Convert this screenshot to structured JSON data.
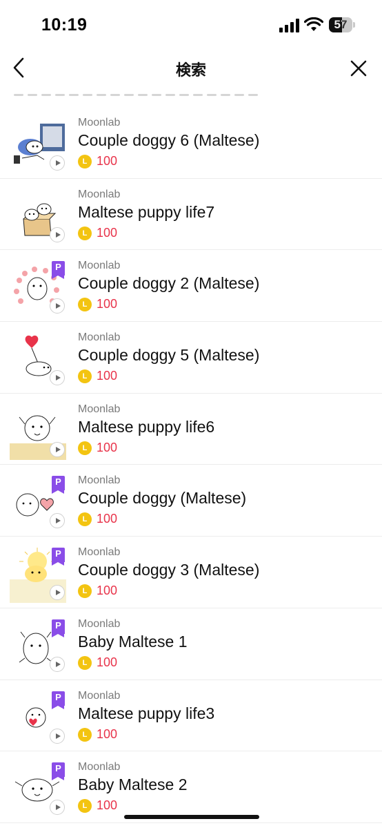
{
  "status_bar": {
    "time": "10:19",
    "battery_level": "57",
    "battery_fraction": 0.57
  },
  "nav": {
    "title": "検索",
    "back_icon": "chevron-left-icon",
    "close_icon": "close-icon"
  },
  "colors": {
    "price": "#e8334a",
    "coin": "#f3c411",
    "premium_badge": "#8a4de8",
    "author": "#7a7a7a"
  },
  "items": [
    {
      "author": "Moonlab",
      "name": "Couple doggy 6 (Maltese)",
      "price": "100",
      "premium": false,
      "premium_label": "",
      "coin_label": "L"
    },
    {
      "author": "Moonlab",
      "name": "Maltese puppy life7",
      "price": "100",
      "premium": false,
      "premium_label": "",
      "coin_label": "L"
    },
    {
      "author": "Moonlab",
      "name": "Couple doggy 2 (Maltese)",
      "price": "100",
      "premium": true,
      "premium_label": "P",
      "coin_label": "L"
    },
    {
      "author": "Moonlab",
      "name": "Couple doggy 5 (Maltese)",
      "price": "100",
      "premium": false,
      "premium_label": "",
      "coin_label": "L"
    },
    {
      "author": "Moonlab",
      "name": "Maltese puppy life6",
      "price": "100",
      "premium": false,
      "premium_label": "",
      "coin_label": "L"
    },
    {
      "author": "Moonlab",
      "name": "Couple doggy (Maltese)",
      "price": "100",
      "premium": true,
      "premium_label": "P",
      "coin_label": "L"
    },
    {
      "author": "Moonlab",
      "name": "Couple doggy 3 (Maltese)",
      "price": "100",
      "premium": true,
      "premium_label": "P",
      "coin_label": "L"
    },
    {
      "author": "Moonlab",
      "name": "Baby Maltese 1",
      "price": "100",
      "premium": true,
      "premium_label": "P",
      "coin_label": "L"
    },
    {
      "author": "Moonlab",
      "name": "Maltese puppy life3",
      "price": "100",
      "premium": true,
      "premium_label": "P",
      "coin_label": "L"
    },
    {
      "author": "Moonlab",
      "name": "Baby Maltese 2",
      "price": "100",
      "premium": true,
      "premium_label": "P",
      "coin_label": "L"
    }
  ]
}
